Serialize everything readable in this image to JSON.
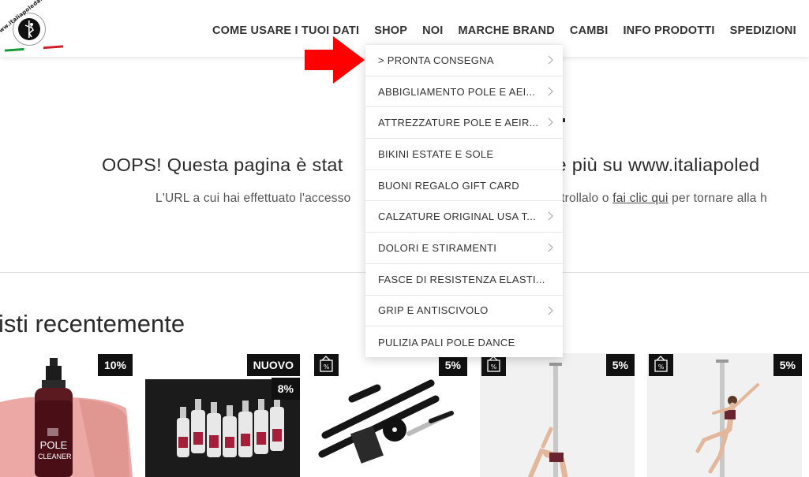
{
  "header": {
    "logo_text": "www.italiapoledanceshop.it",
    "nav": [
      "COME USARE I TUOI DATI",
      "SHOP",
      "NOI",
      "MARCHE BRAND",
      "CAMBI",
      "INFO PRODOTTI",
      "SPEDIZIONI"
    ]
  },
  "dropdown": {
    "items": [
      {
        "label": "> PRONTA CONSEGNA",
        "has_submenu": true
      },
      {
        "label": "ABBIGLIAMENTO POLE E AEI...",
        "has_submenu": true
      },
      {
        "label": "ATTREZZATURE POLE E AEIR...",
        "has_submenu": true
      },
      {
        "label": "BIKINI ESTATE E SOLE",
        "has_submenu": false
      },
      {
        "label": "BUONI REGALO GIFT CARD",
        "has_submenu": false
      },
      {
        "label": "CALZATURE ORIGINAL USA T...",
        "has_submenu": true
      },
      {
        "label": "DOLORI E STIRAMENTI",
        "has_submenu": true
      },
      {
        "label": "FASCE DI RESISTENZA ELASTI...",
        "has_submenu": false
      },
      {
        "label": "GRIP E ANTISCIVOLO",
        "has_submenu": true
      },
      {
        "label": "PULIZIA PALI POLE DANCE",
        "has_submenu": false
      }
    ]
  },
  "hero": {
    "title_left": "OOPS! Questa pagina è stat",
    "title_right": "ste più su www.italiapoled",
    "text_left": "L'URL a cui hai effettuato l'accesso",
    "text_mid": "controllalo o",
    "text_link": "fai clic qui",
    "text_right": "per tornare alla h"
  },
  "section": {
    "title": "isti recentemente"
  },
  "products": [
    {
      "badges": [
        "10%"
      ],
      "product_text": [
        "POLE",
        "CLEANER"
      ]
    },
    {
      "badges": [
        "NUOVO",
        "8%"
      ]
    },
    {
      "badges": [
        "5%"
      ],
      "promo_icon": "percent-tag-icon"
    },
    {
      "badges": [
        "5%"
      ],
      "promo_icon": "percent-tag-icon"
    },
    {
      "badges": [
        "5%"
      ],
      "promo_icon": "percent-tag-icon"
    }
  ],
  "colors": {
    "arrow": "#ff0000",
    "badge_bg": "#111111",
    "text": "#2b2b2b"
  }
}
